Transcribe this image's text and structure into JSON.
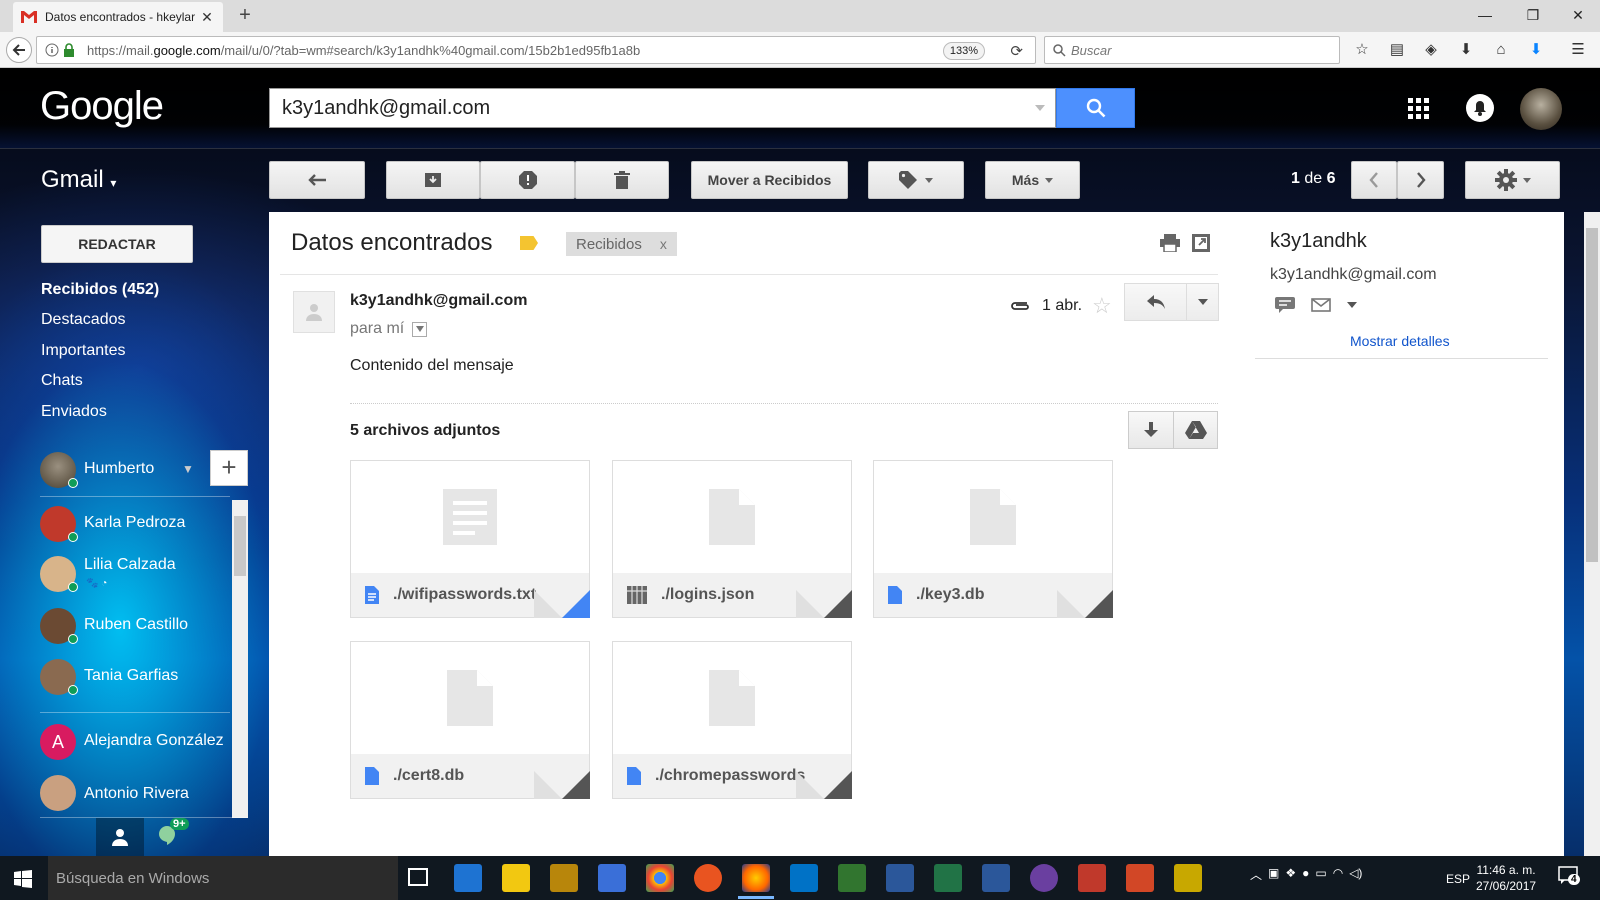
{
  "browser": {
    "tab_title": "Datos encontrados - hkeylar",
    "url_prefix": "https://mail.",
    "url_domain": "google.com",
    "url_rest": "/mail/u/0/?tab=wm#search/k3y1andhk%40gmail.com/15b2b1ed95fb1a8b",
    "zoom": "133%",
    "search_placeholder": "Buscar"
  },
  "google": {
    "logo": "Google",
    "search_value": "k3y1andhk@gmail.com"
  },
  "gmail": {
    "label": "Gmail",
    "toolbar": {
      "move_inbox": "Mover a Recibidos",
      "more": "Más",
      "pager_prefix": "1",
      "pager_mid": " de ",
      "pager_total": "6"
    }
  },
  "nav": {
    "compose": "REDACTAR",
    "items": [
      {
        "label": "Recibidos (452)"
      },
      {
        "label": "Destacados"
      },
      {
        "label": "Importantes"
      },
      {
        "label": "Chats"
      },
      {
        "label": "Enviados"
      }
    ],
    "me": "Humberto",
    "contacts": [
      {
        "name": "Karla Pedroza",
        "color": "#c0392b"
      },
      {
        "name": "Lilia Calzada",
        "color": "#d8b48a"
      },
      {
        "name": "Ruben Castillo",
        "color": "#6b4a33"
      },
      {
        "name": "Tania Garfias",
        "color": "#8a6a50"
      },
      {
        "name": "Alejandra González",
        "color": "#d81b60",
        "initial": "A"
      },
      {
        "name": "Antonio Rivera",
        "color": "#c9a080"
      }
    ],
    "hangouts_badge": "9+"
  },
  "message": {
    "subject": "Datos encontrados",
    "label_chip": "Recibidos",
    "label_chip_close": "x",
    "sender": "k3y1andhk@gmail.com",
    "to": "para mí",
    "date": "1 abr.",
    "body": "Contenido del mensaje",
    "attachments_title": "5 archivos adjuntos",
    "attachments": [
      {
        "name": "./wifipasswords.txt",
        "icon": "text-file-icon",
        "accent": "#4285f4"
      },
      {
        "name": "./logins.json",
        "icon": "table-file-icon",
        "accent": "#555555"
      },
      {
        "name": "./key3.db",
        "icon": "file-icon",
        "accent": "#555555"
      },
      {
        "name": "./cert8.db",
        "icon": "file-icon",
        "accent": "#555555"
      },
      {
        "name": "./chromepasswords",
        "icon": "file-icon",
        "accent": "#555555"
      }
    ]
  },
  "contact_panel": {
    "name": "k3y1andhk",
    "email": "k3y1andhk@gmail.com",
    "details_link": "Mostrar detalles"
  },
  "taskbar": {
    "search_placeholder": "Búsqueda en Windows",
    "lang": "ESP",
    "time": "11:46 a. m.",
    "date": "27/06/2017",
    "notification_count": "4"
  },
  "colors": {
    "accent_blue": "#4d90fe",
    "link": "#1155cc",
    "label_yellow": "#f4c430"
  }
}
